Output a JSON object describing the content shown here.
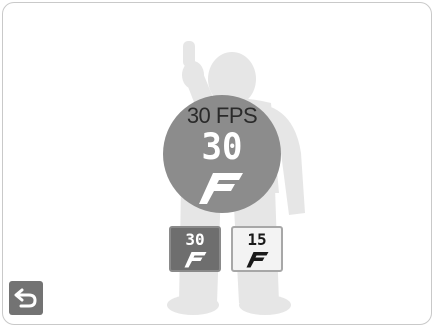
{
  "frame_rate": {
    "label": "30 FPS",
    "current_value": "30",
    "current_icon": "fast-f-icon"
  },
  "options": [
    {
      "value": "30",
      "icon": "fast-f-icon",
      "selected": true
    },
    {
      "value": "15",
      "icon": "fast-f-icon",
      "selected": false
    }
  ],
  "navigation": {
    "back_icon": "return-arrow-icon"
  },
  "colors": {
    "circle": "#8c8c8c",
    "selected_option": "#6e6e6e",
    "unselected_option": "#f3f3f3",
    "back_button": "#737373",
    "silhouette": "#e6e6e6"
  }
}
